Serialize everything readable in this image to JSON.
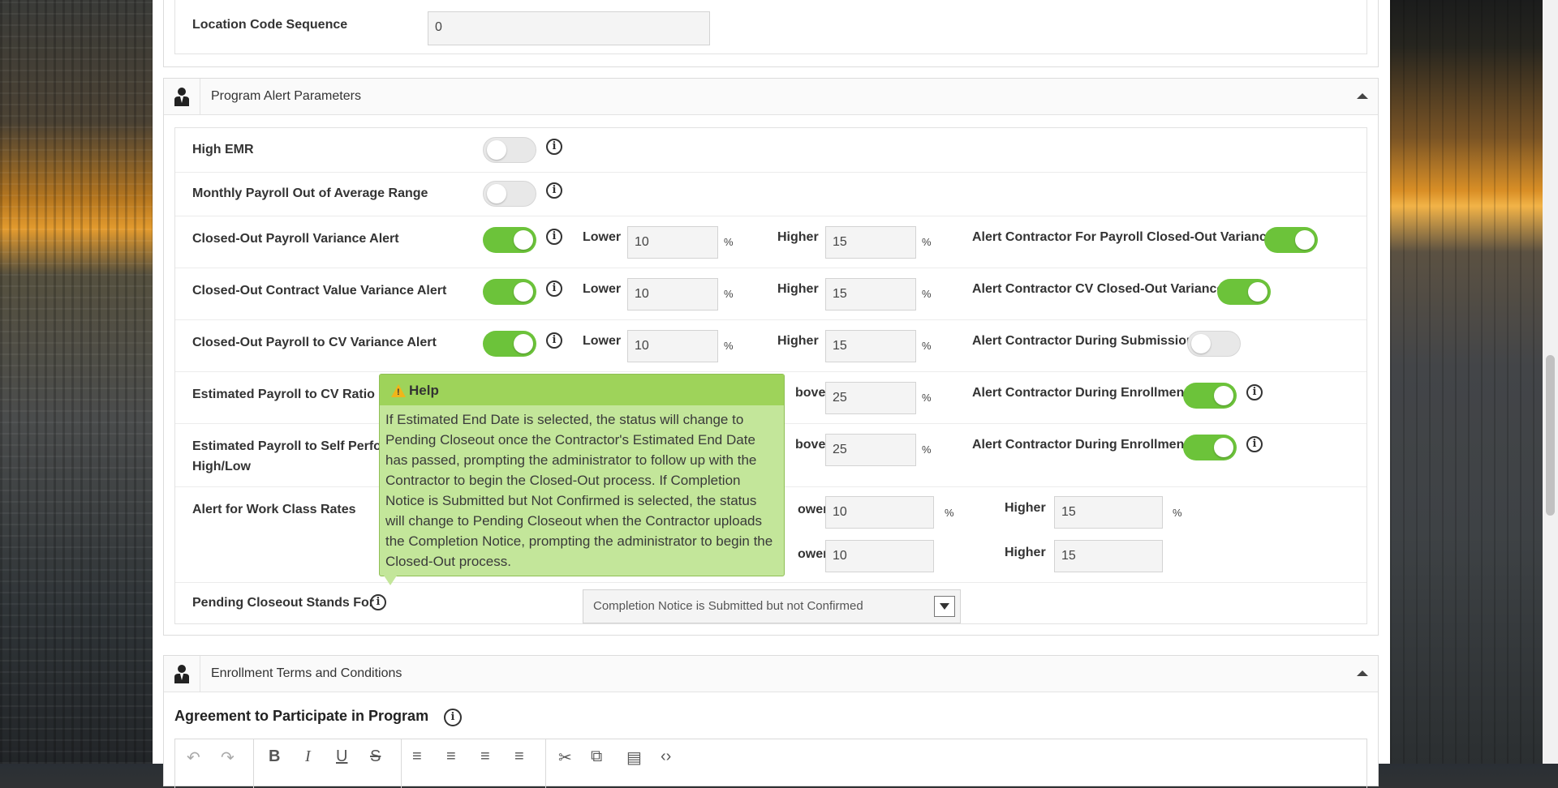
{
  "location": {
    "label": "Location Code Sequence",
    "value": "0"
  },
  "alert_section": {
    "title": "Program Alert Parameters",
    "rows": {
      "high_emr": "High EMR",
      "monthly_payroll": "Monthly Payroll Out of Average Range",
      "payroll_variance": {
        "label": "Closed-Out Payroll Variance Alert",
        "lower_label": "Lower",
        "lower_value": "10",
        "higher_label": "Higher",
        "higher_value": "15",
        "pct": "%",
        "contractor_label": "Alert Contractor For Payroll Closed-Out Variance"
      },
      "cv_variance": {
        "label": "Closed-Out Contract Value Variance Alert",
        "lower_label": "Lower",
        "lower_value": "10",
        "higher_label": "Higher",
        "higher_value": "15",
        "pct": "%",
        "contractor_label": "Alert Contractor CV Closed-Out Variance"
      },
      "payroll_cv_variance": {
        "label": "Closed-Out Payroll to CV Variance Alert",
        "lower_label": "Lower",
        "lower_value": "10",
        "higher_label": "Higher",
        "higher_value": "15",
        "pct": "%",
        "contractor_label": "Alert Contractor During Submission"
      },
      "est_payroll_cv": {
        "label": "Estimated Payroll to CV Ratio H",
        "above_label": "bove",
        "above_value": "25",
        "pct": "%",
        "contractor_label": "Alert Contractor During Enrollment"
      },
      "est_payroll_self": {
        "label_line1": "Estimated Payroll to Self Perfor",
        "label_line2": "High/Low",
        "above_label": "bove",
        "above_value": "25",
        "pct": "%",
        "contractor_label": "Alert Contractor During Enrollment"
      },
      "work_class": {
        "label": "Alert for Work Class Rates",
        "lower_label_1": "ower",
        "lower_value_1": "10",
        "higher_label_1": "Higher",
        "higher_value_1": "15",
        "pct": "%",
        "lower_label_2": "ower",
        "lower_value_2": "10",
        "higher_label_2": "Higher",
        "higher_value_2": "15"
      },
      "pending_closeout": {
        "label": "Pending Closeout Stands For",
        "selected": "Completion Notice is Submitted but not Confirmed"
      }
    }
  },
  "tooltip": {
    "title": "Help",
    "body": "If Estimated End Date is selected, the status will change to Pending Closeout once the Contractor's Estimated End Date has passed, prompting the administrator to follow up with the Contractor to begin the Closed-Out process. If Completion Notice is Submitted but Not Confirmed is selected, the status will change to Pending Closeout when the Contractor uploads the Completion Notice, prompting the administrator to begin the Closed-Out process."
  },
  "enrollment_section": {
    "title": "Enrollment Terms and Conditions",
    "agreement_label": "Agreement to Participate in Program"
  },
  "icons": {
    "section": "person-icon",
    "info": "info-icon",
    "warning": "warning-icon",
    "collapse": "chevron-up-icon"
  },
  "colors": {
    "toggle_on": "#6cc33a",
    "toggle_off": "#e8e8e8",
    "tooltip_bg": "#c3e69a",
    "tooltip_head": "#9ed35a"
  }
}
